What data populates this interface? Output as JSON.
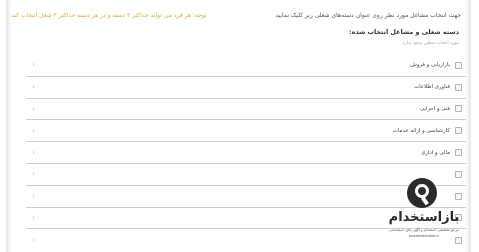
{
  "header": {
    "instruction": "جهت انتخاب مشاغل مورد نظر روی عنوان دسته‌های شغلی زیر کلیک نمایید",
    "note": "توجه: هر فرد می تواند حداکثر ۲ دسته و در هر دسته حداکثر ۳ شغل انتخاب کند"
  },
  "section": {
    "title": "دسته شغلی و مشاغل انتخاب شده:",
    "subtitle": "مورد انتخاب شغلی وجود ندارد"
  },
  "categories": [
    {
      "label": "بازاریابی و فروش"
    },
    {
      "label": "فناوری اطلاعات"
    },
    {
      "label": "فنی و اجرایی"
    },
    {
      "label": "کارشناسی و ارائه خدمات"
    },
    {
      "label": "مالی و اداری"
    },
    {
      "label": ""
    },
    {
      "label": ""
    },
    {
      "label": ""
    },
    {
      "label": ""
    }
  ],
  "icons": {
    "chevron": "chevron-left-icon",
    "checkbox": "checkbox-icon"
  },
  "watermark": {
    "brand": "بازاستخدام",
    "tagline": "مرجع تخصصی استخدام و آگهی های استخدامی",
    "url": "bazestekhdam.ir"
  },
  "colors": {
    "note": "#e8a23c",
    "divider": "#cfcfcf"
  }
}
